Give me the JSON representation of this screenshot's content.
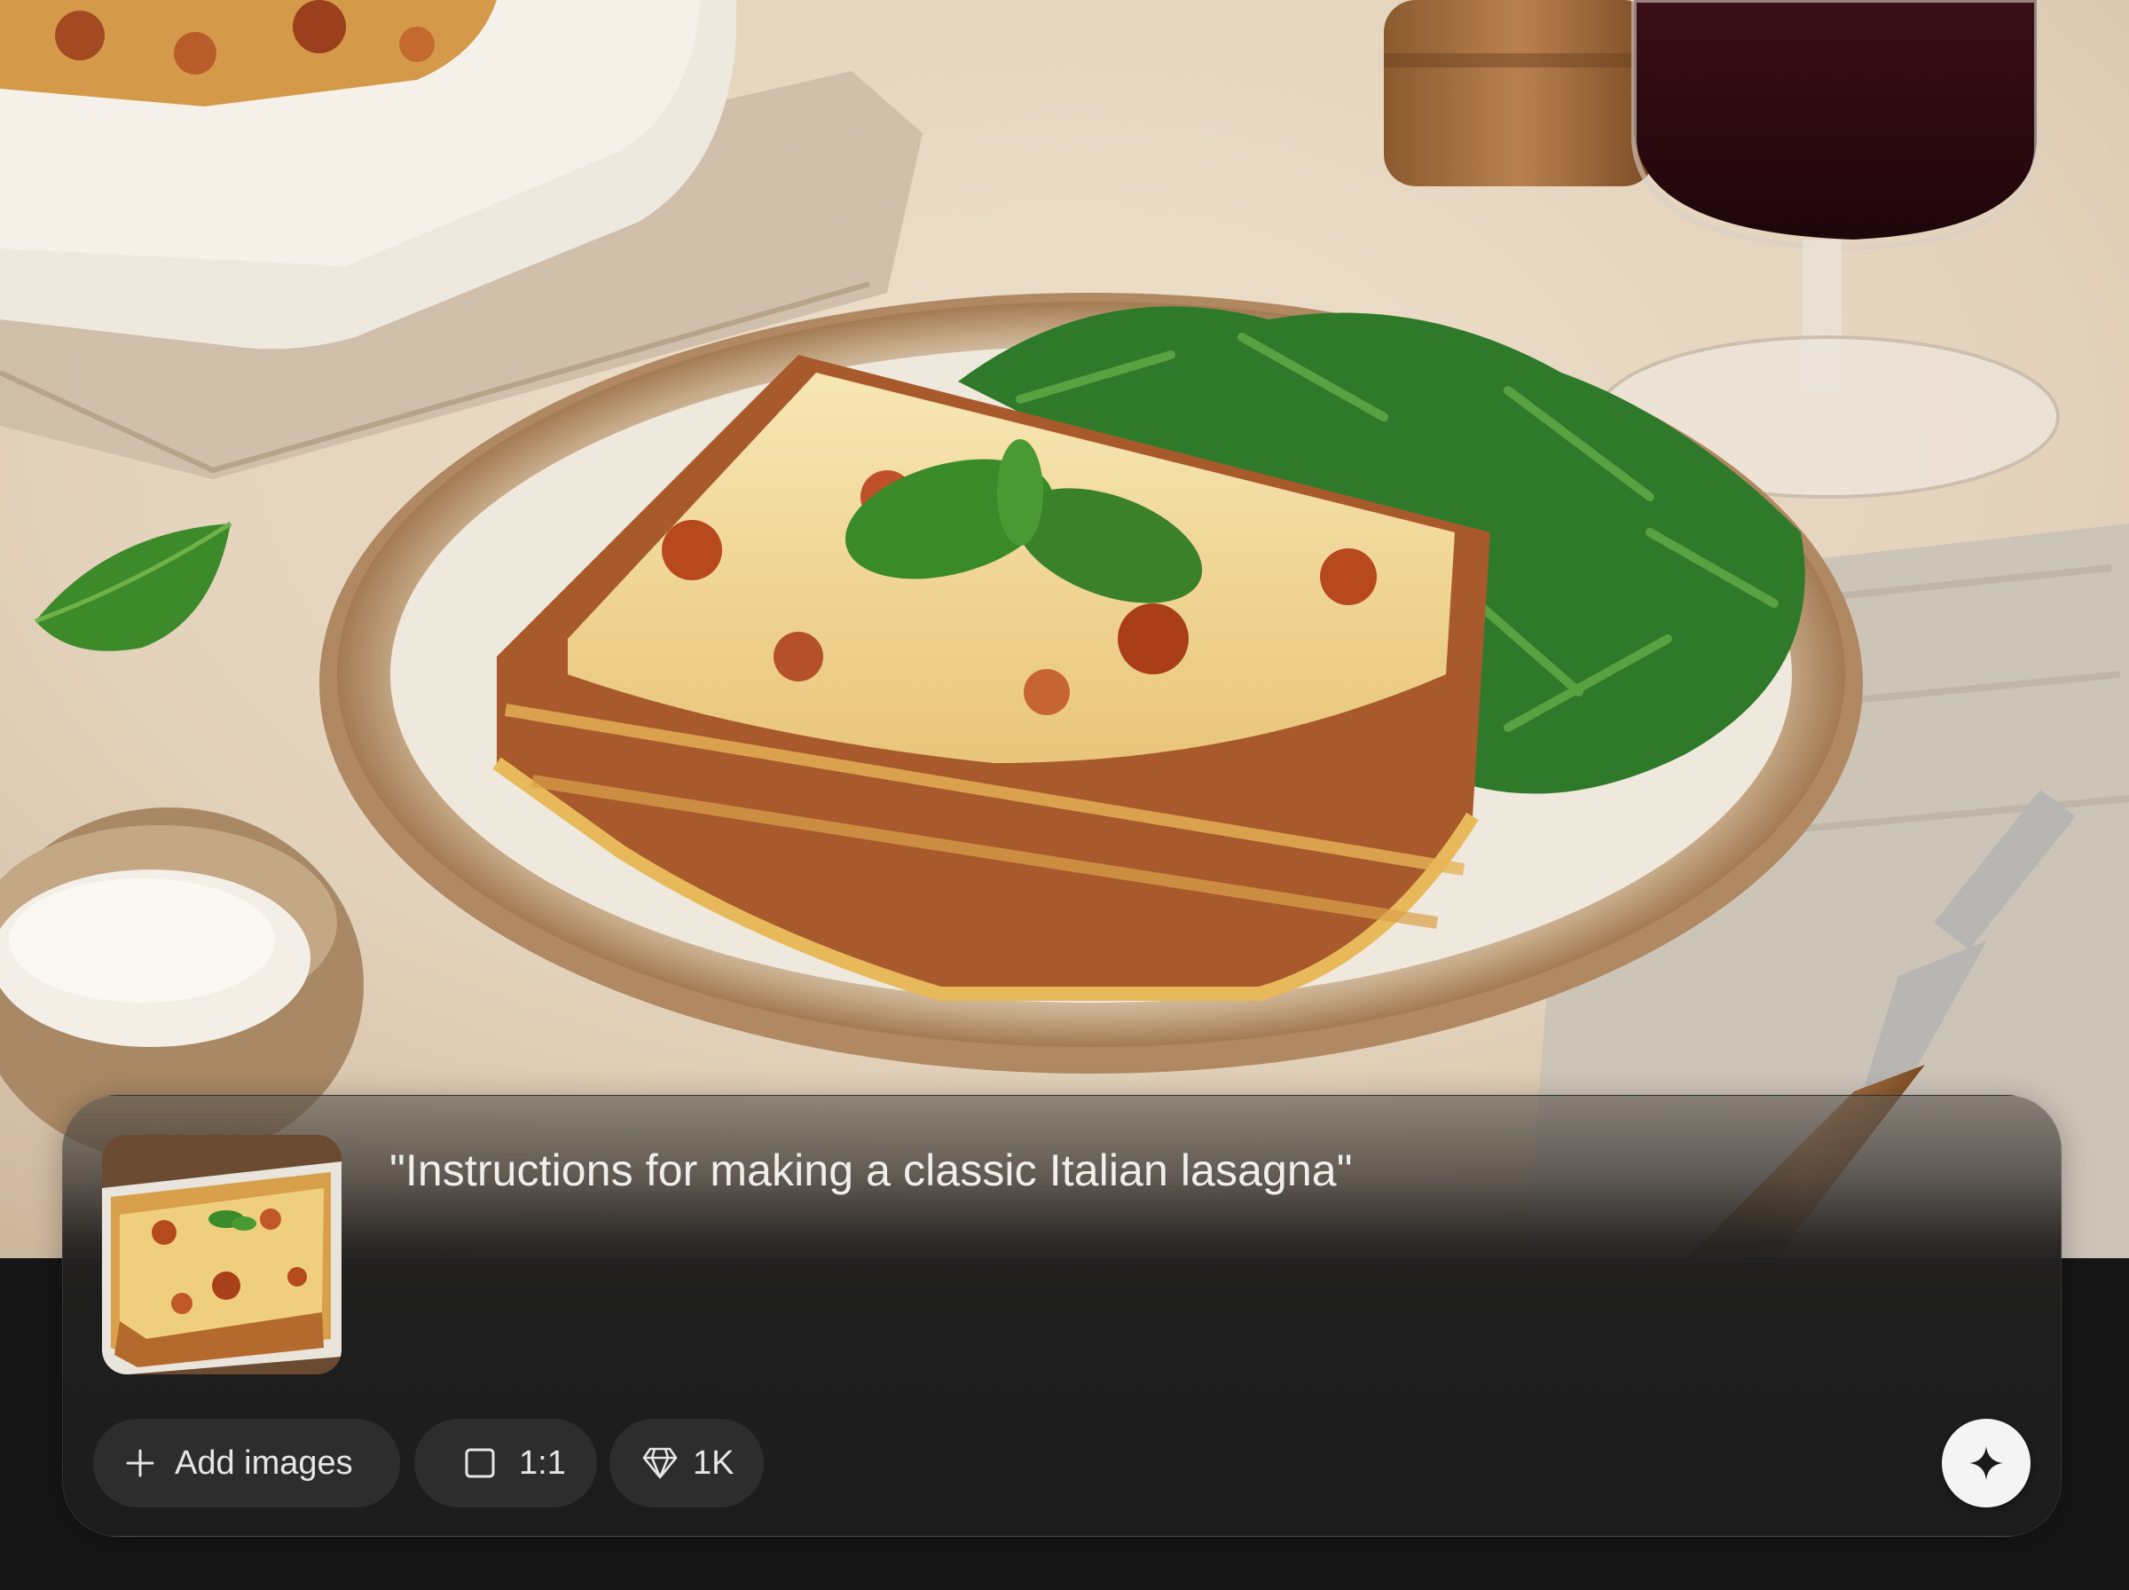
{
  "composer": {
    "prompt": "\"Instructions for making a classic Italian lasagna\"",
    "thumbnail_icon": "image-thumbnail",
    "add_images_label": "Add images",
    "aspect_ratio_label": "1:1",
    "quality_label": "1K",
    "generate_icon": "sparkle-icon"
  },
  "colors": {
    "background": "#161616",
    "card": "#1e1e1e",
    "pill": "#2d2d2e",
    "pill_text": "#e6e6e6",
    "generate_button": "#f4f4f4",
    "prompt_text": "#f1efec"
  },
  "icons": {
    "add": "plus-icon",
    "aspect_ratio": "square-icon",
    "quality": "diamond-icon",
    "generate": "sparkle-icon"
  }
}
